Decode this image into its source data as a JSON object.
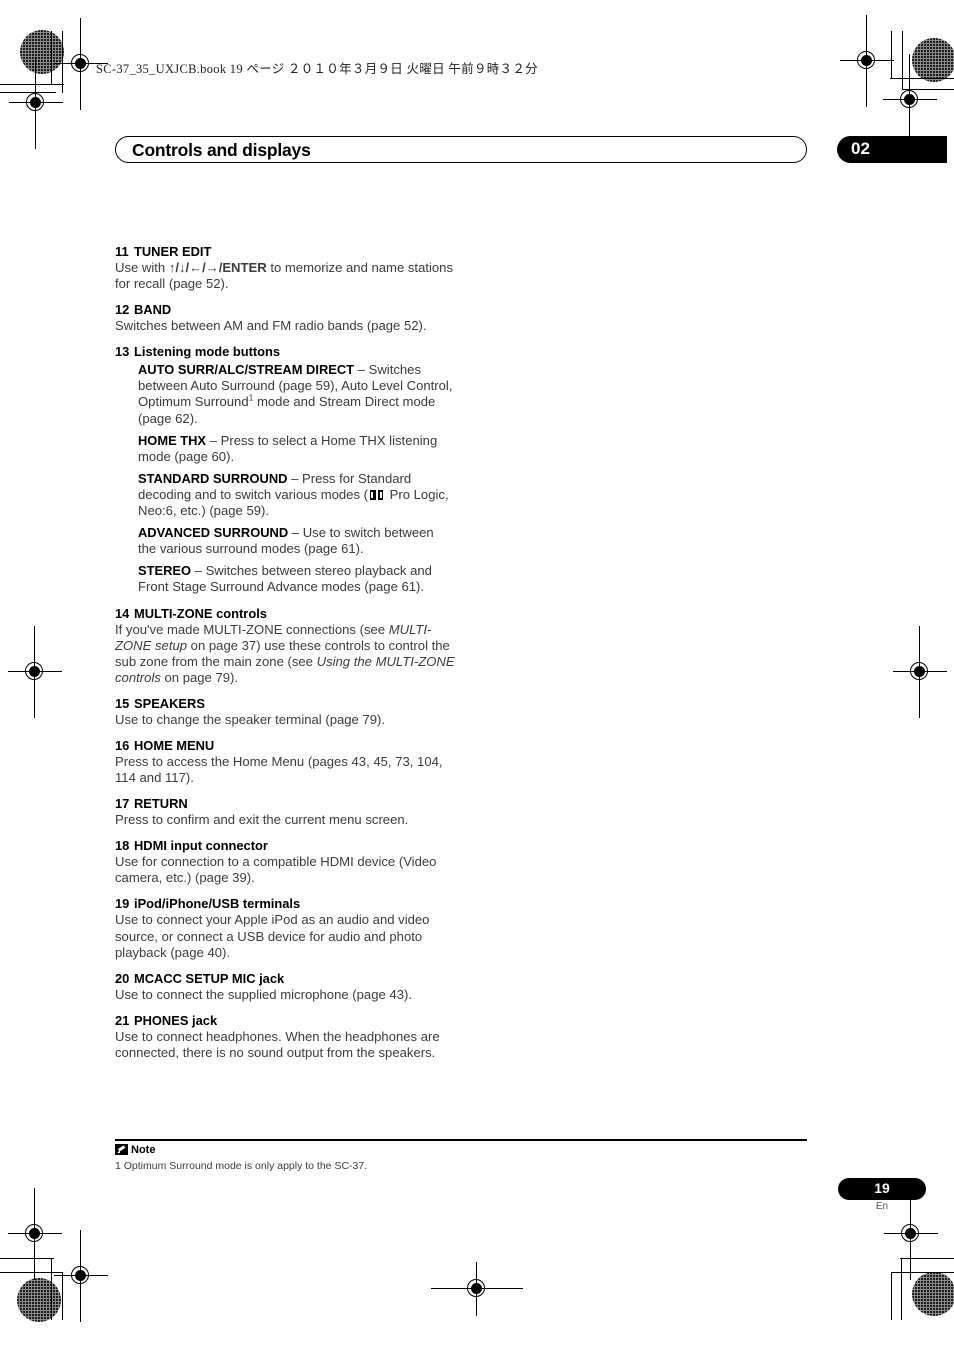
{
  "header": {
    "book_line": "SC-37_35_UXJCB.book   19 ページ   ２０１０年３月９日   火曜日   午前９時３２分",
    "chapter_title": "Controls and displays",
    "chapter_number": "02"
  },
  "entries": [
    {
      "num": "11",
      "title": "TUNER EDIT",
      "body_pre": "Use with ",
      "arrows": "↑/↓/←/→/",
      "bold_inline": "ENTER",
      "body_post": " to memorize and name stations for recall (page 52)."
    },
    {
      "num": "12",
      "title": "BAND",
      "body": "Switches between AM and FM radio bands (page 52)."
    },
    {
      "num": "13",
      "title": "Listening mode buttons",
      "sub_entries": [
        {
          "label": "AUTO SURR/ALC/STREAM DIRECT",
          "text_a": " – Switches between Auto Surround (page 59), Auto Level Control, Optimum Surround",
          "footnote_marker": "1",
          "text_b": " mode and Stream Direct mode (page 62)."
        },
        {
          "label": "HOME THX",
          "text_a": " – Press to select a Home THX listening mode (page 60)."
        },
        {
          "label": "STANDARD SURROUND",
          "text_a": " – Press for Standard decoding and to switch various modes (",
          "dolby_icon": "dolby-double-d-icon",
          "text_b": " Pro Logic, Neo:6, etc.) (page 59)."
        },
        {
          "label": "ADVANCED SURROUND",
          "text_a": " – Use to switch between the various surround modes (page 61)."
        },
        {
          "label": "STEREO",
          "text_a": " – Switches between stereo playback and Front Stage Surround Advance modes (page 61)."
        }
      ]
    },
    {
      "num": "14",
      "title": "MULTI-ZONE controls",
      "rich": [
        {
          "t": "If you've made MULTI-ZONE connections (see ",
          "i": false
        },
        {
          "t": "MULTI-ZONE setup",
          "i": true
        },
        {
          "t": " on page 37) use these controls to control the sub zone from the main zone (see ",
          "i": false
        },
        {
          "t": "Using the MULTI-ZONE controls",
          "i": true
        },
        {
          "t": " on page 79).",
          "i": false
        }
      ]
    },
    {
      "num": "15",
      "title": "SPEAKERS",
      "body": "Use to change the speaker terminal (page 79)."
    },
    {
      "num": "16",
      "title": "HOME MENU",
      "body": "Press to access the Home Menu (pages 43, 45, 73, 104, 114 and 117)."
    },
    {
      "num": "17",
      "title": "RETURN",
      "body": "Press to confirm and exit the current menu screen."
    },
    {
      "num": "18",
      "title": "HDMI input connector",
      "body": "Use for connection to a compatible HDMI device (Video camera, etc.) (page 39)."
    },
    {
      "num": "19",
      "title": "iPod/iPhone/USB terminals",
      "body": "Use to connect your Apple iPod as an audio and video source, or connect a USB device for audio and photo playback (page 40)."
    },
    {
      "num": "20",
      "title": "MCACC SETUP MIC jack",
      "body": "Use to connect the supplied microphone (page 43)."
    },
    {
      "num": "21",
      "title": "PHONES jack",
      "body": "Use to connect headphones. When the headphones are connected, there is no sound output from the speakers."
    }
  ],
  "footnote": {
    "heading": "Note",
    "icon": "note-pencil-icon",
    "text": "1 Optimum Surround mode is only apply to the SC-37."
  },
  "footer": {
    "page_number": "19",
    "language": "En"
  }
}
